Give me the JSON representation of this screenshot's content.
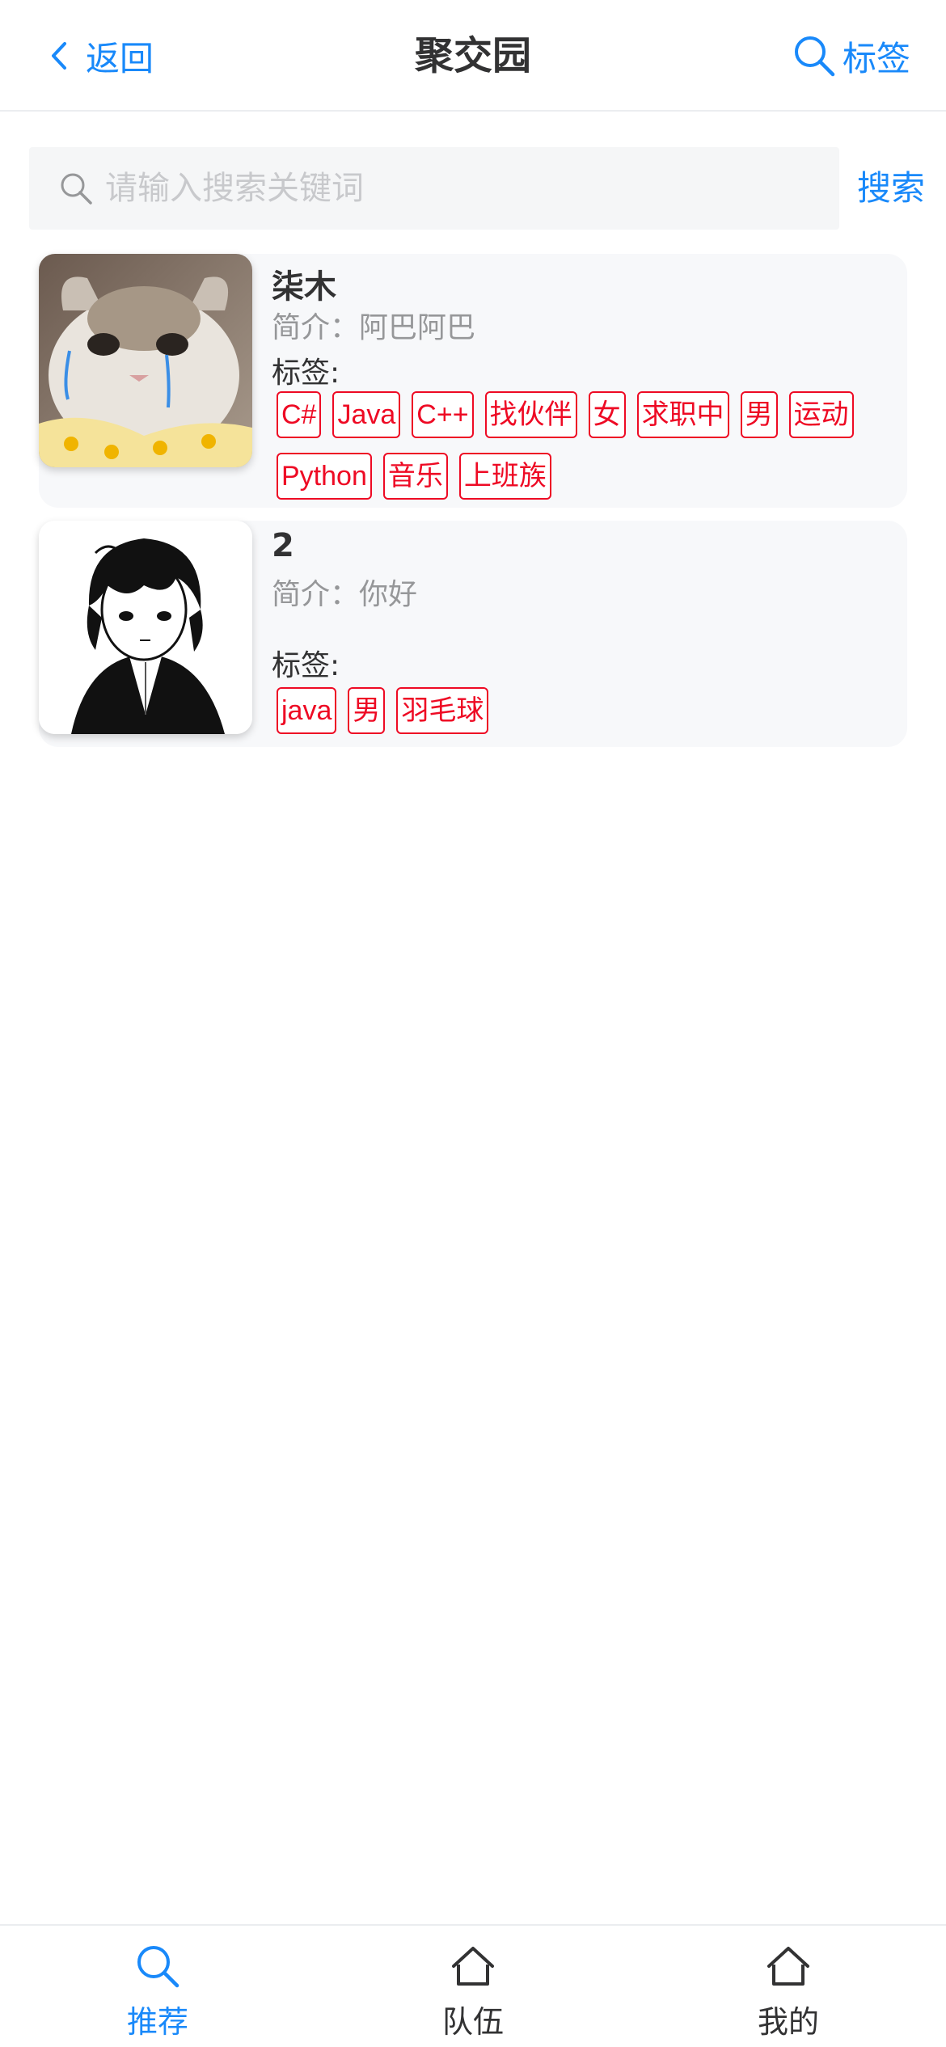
{
  "navbar": {
    "back_label": "返回",
    "title": "聚交园",
    "tags_label": "标签",
    "back_icon": "chevron-left-icon",
    "tags_icon": "search-icon"
  },
  "search": {
    "placeholder": "请输入搜索关键词",
    "value": "",
    "action_label": "搜索",
    "icon": "search-icon"
  },
  "users": [
    {
      "name": "柒木",
      "intro": "简介：阿巴阿巴",
      "tags_label": "标签:",
      "tags": [
        "C#",
        "Java",
        "C++",
        "找伙伴",
        "女",
        "求职中",
        "男",
        "运动",
        "Python",
        "音乐",
        "上班族"
      ],
      "avatar": "crying-cat-photo"
    },
    {
      "name": "2",
      "intro": "简介：你好",
      "tags_label": "标签:",
      "tags": [
        "java",
        "男",
        "羽毛球"
      ],
      "avatar": "anime-boy-illustration"
    }
  ],
  "tabbar": {
    "items": [
      {
        "label": "推荐",
        "icon": "search-icon",
        "active": true
      },
      {
        "label": "队伍",
        "icon": "home-icon",
        "active": false
      },
      {
        "label": "我的",
        "icon": "home-icon",
        "active": false
      }
    ]
  },
  "colors": {
    "accent": "#1989fa",
    "tag": "#ee0a24",
    "card_bg": "#f7f8fa"
  }
}
